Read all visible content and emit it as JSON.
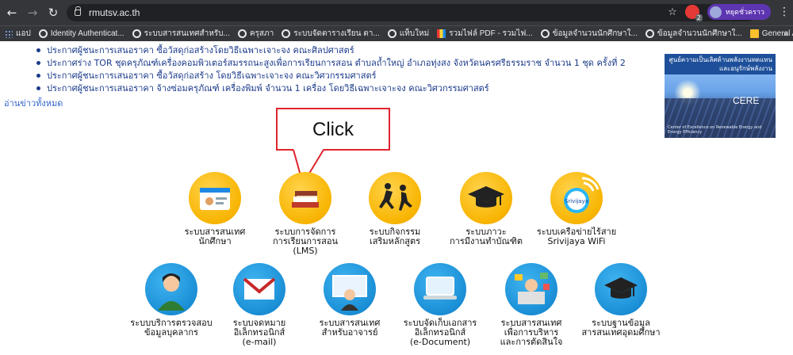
{
  "browser": {
    "url": "rmutsv.ac.th",
    "profile_name": "หยุดชั่วคราว",
    "ext_badge": "2",
    "bookmarks": [
      {
        "label": "แอป",
        "icon": "apps-icon"
      },
      {
        "label": "Identity Authenticat...",
        "icon": "globe-icon"
      },
      {
        "label": "ระบบสารสนเทศสำหรับ...",
        "icon": "globe-icon"
      },
      {
        "label": "ครุสภา",
        "icon": "globe-icon"
      },
      {
        "label": "ระบบจัดตารางเรียน ตา...",
        "icon": "globe-icon"
      },
      {
        "label": "แท็บใหม่",
        "icon": "globe-icon"
      },
      {
        "label": "รวมไฟล์ PDF - รวมไฟ...",
        "icon": "flag-icon"
      },
      {
        "label": "ข้อมูลจำนวนนักศึกษาใ...",
        "icon": "globe-icon"
      },
      {
        "label": "ข้อมูลจำนวนนักศึกษาใ...",
        "icon": "globe-icon"
      },
      {
        "label": "General Affairs Man...",
        "icon": "doc-icon"
      }
    ],
    "more_bookmarks": "»"
  },
  "news": {
    "items": [
      "ประกาศผู้ชนะการเสนอราคา ซื้อวัสดุก่อสร้างโดยวิธีเฉพาะเจาะจง คณะศิลปศาสตร์",
      "ประกาศร่าง TOR ชุดครุภัณฑ์เครื่องคอมพิวเตอร์สมรรถนะสูงเพื่อการเรียนการสอน ตำบลถ้ำใหญ่ อำเภอทุ่งสง จังหวัดนครศรีธรรมราช จำนวน 1 ชุด ครั้งที่ 2",
      "ประกาศผู้ชนะการเสนอราคา ซื้อวัสดุก่อสร้าง โดยวิธีเฉพาะเจาะจง คณะวิศวกรรมศาสตร์",
      "ประกาศผู้ชนะการเสนอราคา จ้างซ่อมครุภัณฑ์ เครื่องพิมพ์ จำนวน 1 เครื่อง โดยวิธีเฉพาะเจาะจง คณะวิศวกรรมศาสตร์"
    ],
    "read_all": "อ่านข่าวทั้งหมด"
  },
  "banner": {
    "title": "ศูนย์ความเป็นเลิศด้านพลังงานทดแทนและอนุรักษ์พลังงาน",
    "label": "CERE",
    "subtitle": "Center of Excellence on Renewable Energy and Energy Efficiency"
  },
  "callout": {
    "text": "Click"
  },
  "tiles_row1": [
    {
      "label": "ระบบสารสนเทศ\nนักศึกษา",
      "color": "#f8b400",
      "icon": "student-card-icon"
    },
    {
      "label": "ระบบการจัดการ\nการเรียนการสอน\n(LMS)",
      "color": "#f8b400",
      "icon": "books-icon"
    },
    {
      "label": "ระบบกิจกรรม\nเสริมหลักสูตร",
      "color": "#f8b400",
      "icon": "activity-icon"
    },
    {
      "label": "ระบบภาวะ\nการมีงานทำบัณฑิต",
      "color": "#f8b400",
      "icon": "graduation-cap-icon"
    },
    {
      "label": "ระบบเครือข่ายไร้สาย\nSrivijaya WiFi",
      "color": "#f8b400",
      "icon": "wifi-icon"
    }
  ],
  "tiles_row2": [
    {
      "label": "ระบบบริการตรวจสอบ\nข้อมูลบุคลากร",
      "color": "#1b8fd6",
      "icon": "person-icon"
    },
    {
      "label": "ระบบจดหมาย\nอิเล็กทรอนิกส์\n(e-mail)",
      "color": "#1b8fd6",
      "icon": "mail-icon"
    },
    {
      "label": "ระบบสารสนเทศ\nสำหรับอาจารย์",
      "color": "#1b8fd6",
      "icon": "teacher-icon"
    },
    {
      "label": "ระบบจัดเก็บเอกสาร\nอิเล็กทรอนิกส์\n(e-Document)",
      "color": "#1b8fd6",
      "icon": "laptop-icon"
    },
    {
      "label": "ระบบสารสนเทศ\nเพื่อการบริหาร\nและการตัดสินใจ",
      "color": "#1b8fd6",
      "icon": "management-icon"
    },
    {
      "label": "ระบบฐานข้อมูล\nสารสนเทศอุดมศึกษา",
      "color": "#1b8fd6",
      "icon": "database-icon"
    }
  ]
}
